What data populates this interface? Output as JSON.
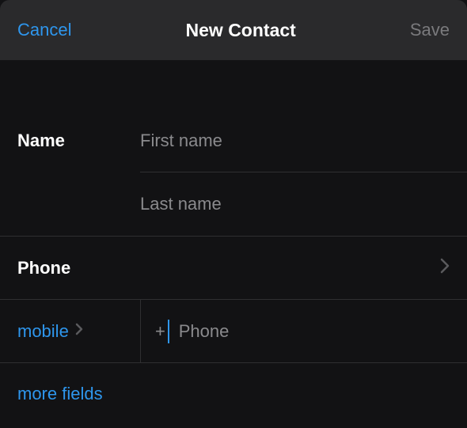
{
  "header": {
    "cancel": "Cancel",
    "title": "New Contact",
    "save": "Save"
  },
  "name_section": {
    "label": "Name",
    "first_placeholder": "First name",
    "last_placeholder": "Last name",
    "first_value": "",
    "last_value": ""
  },
  "phone_section": {
    "label": "Phone",
    "type_label": "mobile",
    "prefix": "+",
    "placeholder": "Phone",
    "value": ""
  },
  "more_fields": "more fields"
}
